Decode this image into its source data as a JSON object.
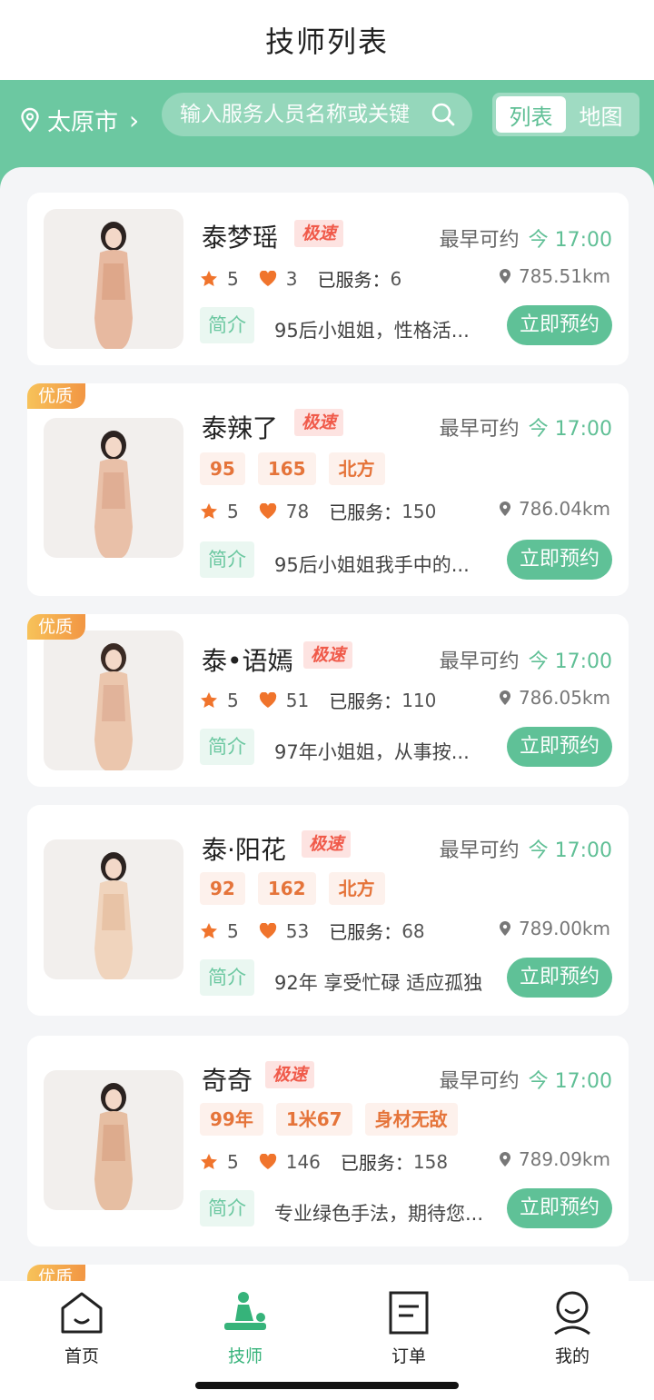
{
  "header": {
    "title": "技师列表"
  },
  "filter": {
    "city": "太原市",
    "search_placeholder": "输入服务人员名称或关键",
    "view_options": [
      "列表",
      "地图"
    ],
    "active_view": "列表"
  },
  "labels": {
    "earliest": "最早可约",
    "served": "已服务：",
    "intro": "简介",
    "book": "立即预约",
    "speed": "极速",
    "quality": "优质"
  },
  "colors": {
    "accent": "#6cc8a1",
    "speed_badge": "#f05a4a",
    "tag_text": "#e5743a"
  },
  "technicians": [
    {
      "name": "泰梦瑶",
      "time": "今 17:00",
      "rating": "5",
      "likes": "3",
      "served": "6",
      "distance": "785.51km",
      "tags": [],
      "intro": "95后小姐姐，性格活...",
      "quality": false
    },
    {
      "name": "泰辣了",
      "time": "今 17:00",
      "rating": "5",
      "likes": "78",
      "served": "150",
      "distance": "786.04km",
      "tags": [
        "95",
        "165",
        "北方"
      ],
      "intro": "95后小姐姐我手中的...",
      "quality": true
    },
    {
      "name": "泰•语嫣",
      "time": "今 17:00",
      "rating": "5",
      "likes": "51",
      "served": "110",
      "distance": "786.05km",
      "tags": [],
      "intro": "97年小姐姐，从事按...",
      "quality": true
    },
    {
      "name": "泰·阳花",
      "time": "今 17:00",
      "rating": "5",
      "likes": "53",
      "served": "68",
      "distance": "789.00km",
      "tags": [
        "92",
        "162",
        "北方"
      ],
      "intro": "92年 享受忙碌 适应孤独",
      "quality": false
    },
    {
      "name": "奇奇",
      "time": "今 17:00",
      "rating": "5",
      "likes": "146",
      "served": "158",
      "distance": "789.09km",
      "tags": [
        "99年",
        "1米67",
        "身材无敌"
      ],
      "intro": "专业绿色手法，期待您...",
      "quality": false
    }
  ],
  "next_card_quality": "优质",
  "tabbar": [
    {
      "label": "首页",
      "icon": "home-icon"
    },
    {
      "label": "技师",
      "icon": "massage-icon"
    },
    {
      "label": "订单",
      "icon": "order-icon"
    },
    {
      "label": "我的",
      "icon": "profile-icon"
    }
  ]
}
